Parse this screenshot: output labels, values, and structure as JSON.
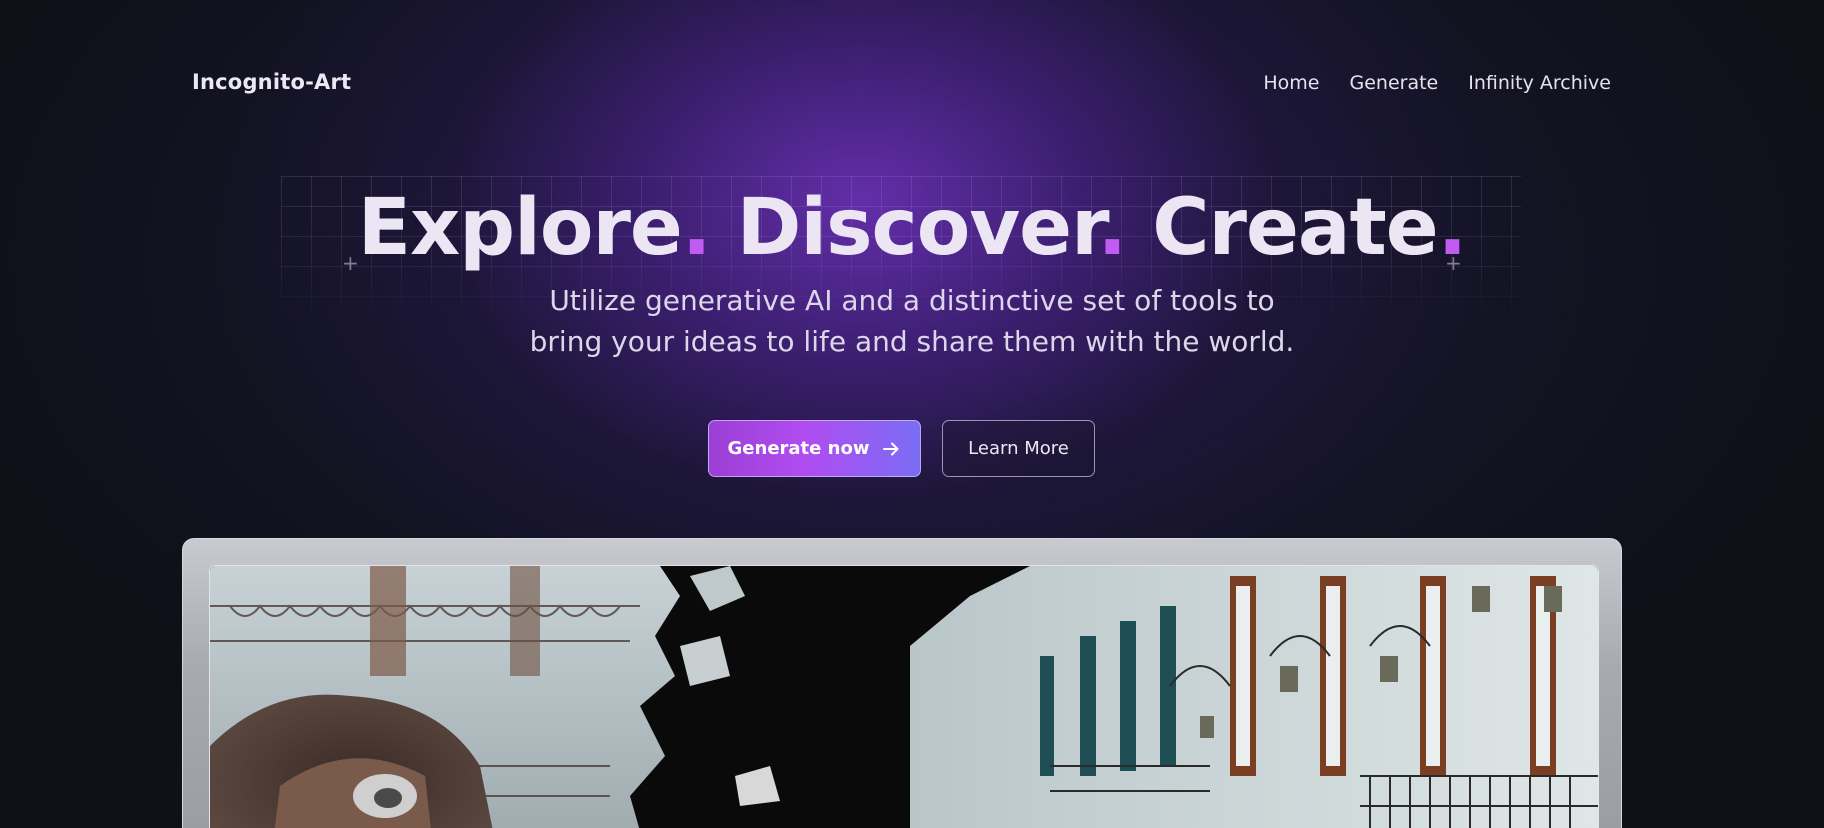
{
  "header": {
    "logo": "Incognito-Art",
    "nav": [
      "Home",
      "Generate",
      "Infinity Archive"
    ]
  },
  "hero": {
    "headline_words": [
      "Explore",
      "Discover",
      "Create"
    ],
    "headline_dot": ".",
    "subtitle_line1": "Utilize generative AI and a distinctive set of tools to",
    "subtitle_line2": "bring your ideas to life and share them with the world.",
    "primary_button": "Generate now",
    "primary_button_icon": "arrow-right-icon",
    "secondary_button": "Learn More"
  },
  "showcase": {
    "image_subject": "hooded-figure-street-collage"
  },
  "colors": {
    "accent": "#c05cf2",
    "background": "#0e1118",
    "glow": "#7032be",
    "button_gradient_start": "#9b3fd4",
    "button_gradient_end": "#7a6df5"
  }
}
